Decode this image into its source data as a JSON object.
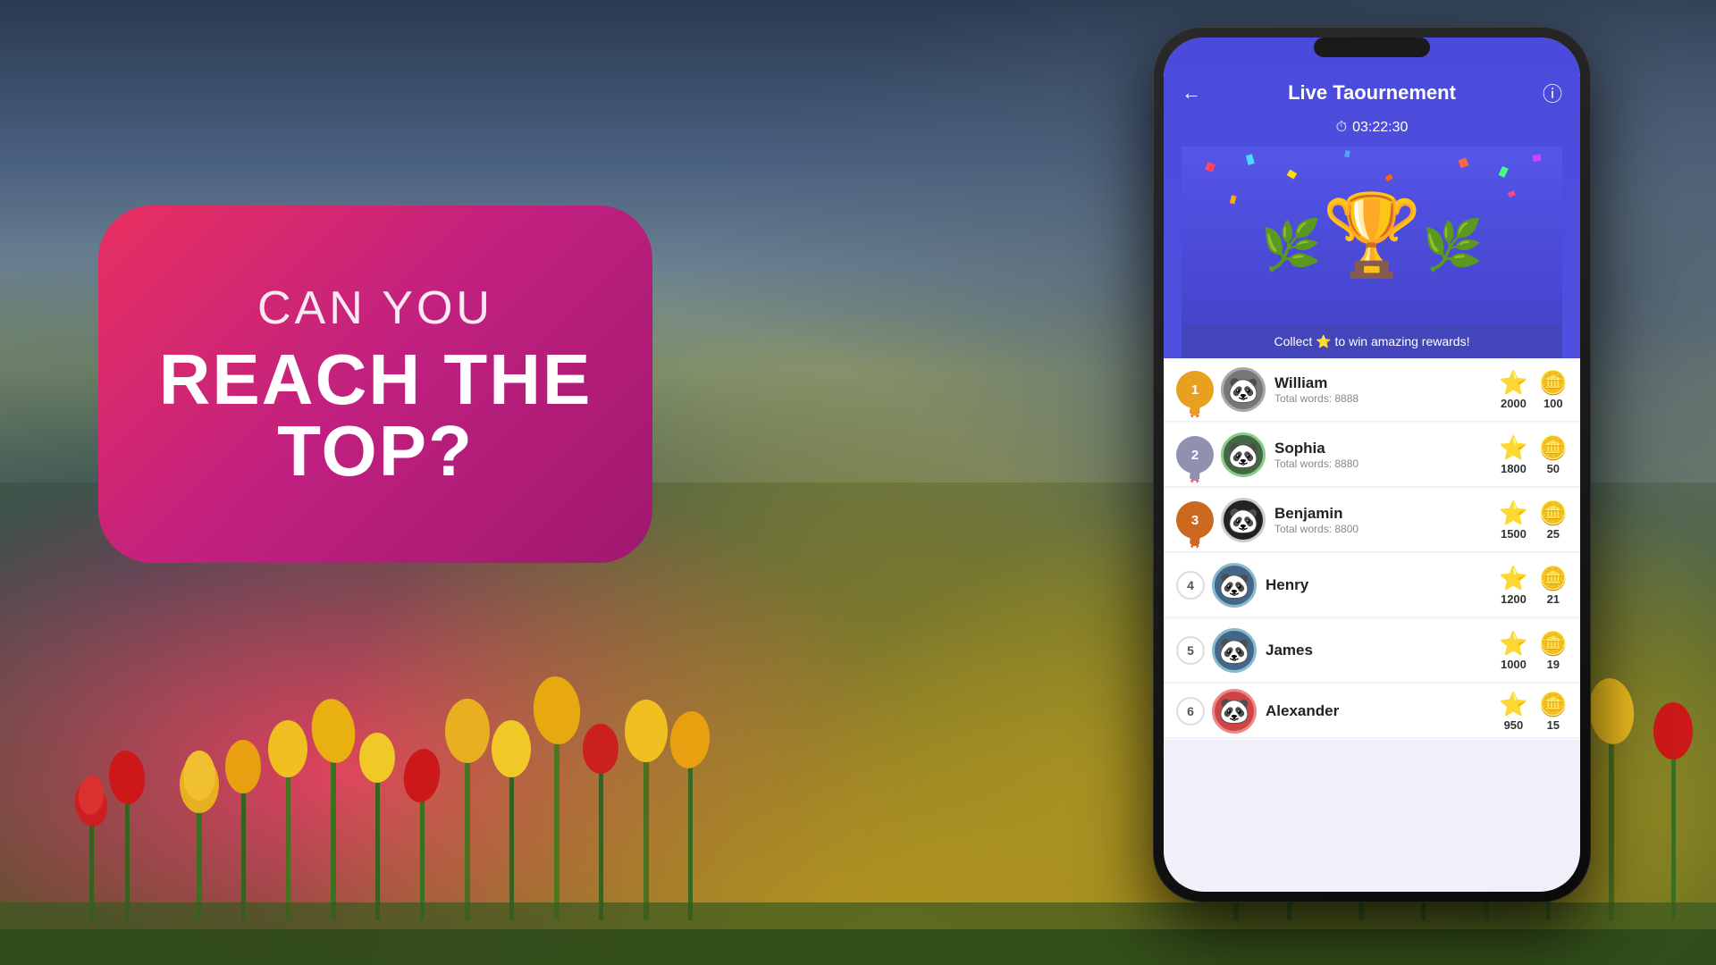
{
  "background": {
    "alt": "Tulip field with mountains"
  },
  "promo": {
    "line1": "CAN YOU",
    "line2": "REACH THE",
    "line3": "TOP?"
  },
  "app": {
    "title": "Live Taournement",
    "timer": "03:22:30",
    "timer_icon": "⏱",
    "collect_text": "Collect ⭐ to win amazing rewards!",
    "back_icon": "←",
    "info_icon": "ⓘ"
  },
  "leaderboard": [
    {
      "rank": 1,
      "name": "William",
      "words": "Total words: 8888",
      "stars": 2000,
      "coins": 100,
      "medal_color": "#e8a020",
      "avatar_border": "#cccccc",
      "avatar_bg": "#888888"
    },
    {
      "rank": 2,
      "name": "Sophia",
      "words": "Total words: 8880",
      "stars": 1800,
      "coins": 50,
      "medal_color": "#9090b0",
      "avatar_border": "#88bb88",
      "avatar_bg": "#446644"
    },
    {
      "rank": 3,
      "name": "Benjamin",
      "words": "Total words: 8800",
      "stars": 1500,
      "coins": 25,
      "medal_color": "#cc7030",
      "avatar_border": "#cccccc",
      "avatar_bg": "#222222"
    },
    {
      "rank": 4,
      "name": "Henry",
      "words": "",
      "stars": 1200,
      "coins": 21,
      "avatar_border": "#88bbcc",
      "avatar_bg": "#446688"
    },
    {
      "rank": 5,
      "name": "James",
      "words": "",
      "stars": 1000,
      "coins": 19,
      "avatar_border": "#88bbcc",
      "avatar_bg": "#446688"
    },
    {
      "rank": 6,
      "name": "Alexander",
      "words": "",
      "stars": 950,
      "coins": 15,
      "avatar_border": "#ee8888",
      "avatar_bg": "#cc4444"
    }
  ]
}
